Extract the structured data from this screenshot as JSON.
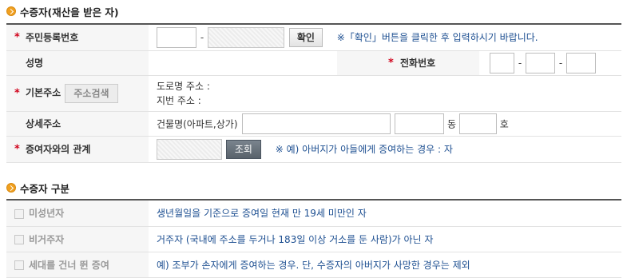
{
  "section1": {
    "title": "수증자(재산을 받은 자)"
  },
  "rrn": {
    "label": "주민등록번호",
    "button": "확인",
    "note": "※「확인」버튼을 클릭한 후 입력하시기 바랍니다."
  },
  "name": {
    "label": "성명"
  },
  "phone": {
    "label": "전화번호"
  },
  "address": {
    "label": "기본주소",
    "search_button": "주소검색",
    "road": "도로명 주소 :",
    "lot": "지번 주소 :"
  },
  "detail": {
    "label": "상세주소",
    "building_label": "건물명(아파트,상가)",
    "dong": "동",
    "ho": "호"
  },
  "relation": {
    "label": "증여자와의 관계",
    "button": "조회",
    "note": "※ 예) 아버지가 아들에게 증여하는 경우 : 자"
  },
  "section2": {
    "title": "수증자 구분"
  },
  "types": [
    {
      "label": "미성년자",
      "desc": "생년월일을 기준으로 증여일 현재 만 19세 미만인 자"
    },
    {
      "label": "비거주자",
      "desc": "거주자 (국내에 주소를 두거나 183일 이상 거소를 둔 사람)가 아닌 자"
    },
    {
      "label": "세대를 건너 뛴 증여",
      "desc": "예) 조부가 손자에게 증여하는 경우. 단, 수증자의 아버지가 사망한 경우는 제외"
    }
  ],
  "colors": {
    "required": "#d0021b",
    "note": "#1d4f91",
    "bullet": "#f0a020"
  }
}
